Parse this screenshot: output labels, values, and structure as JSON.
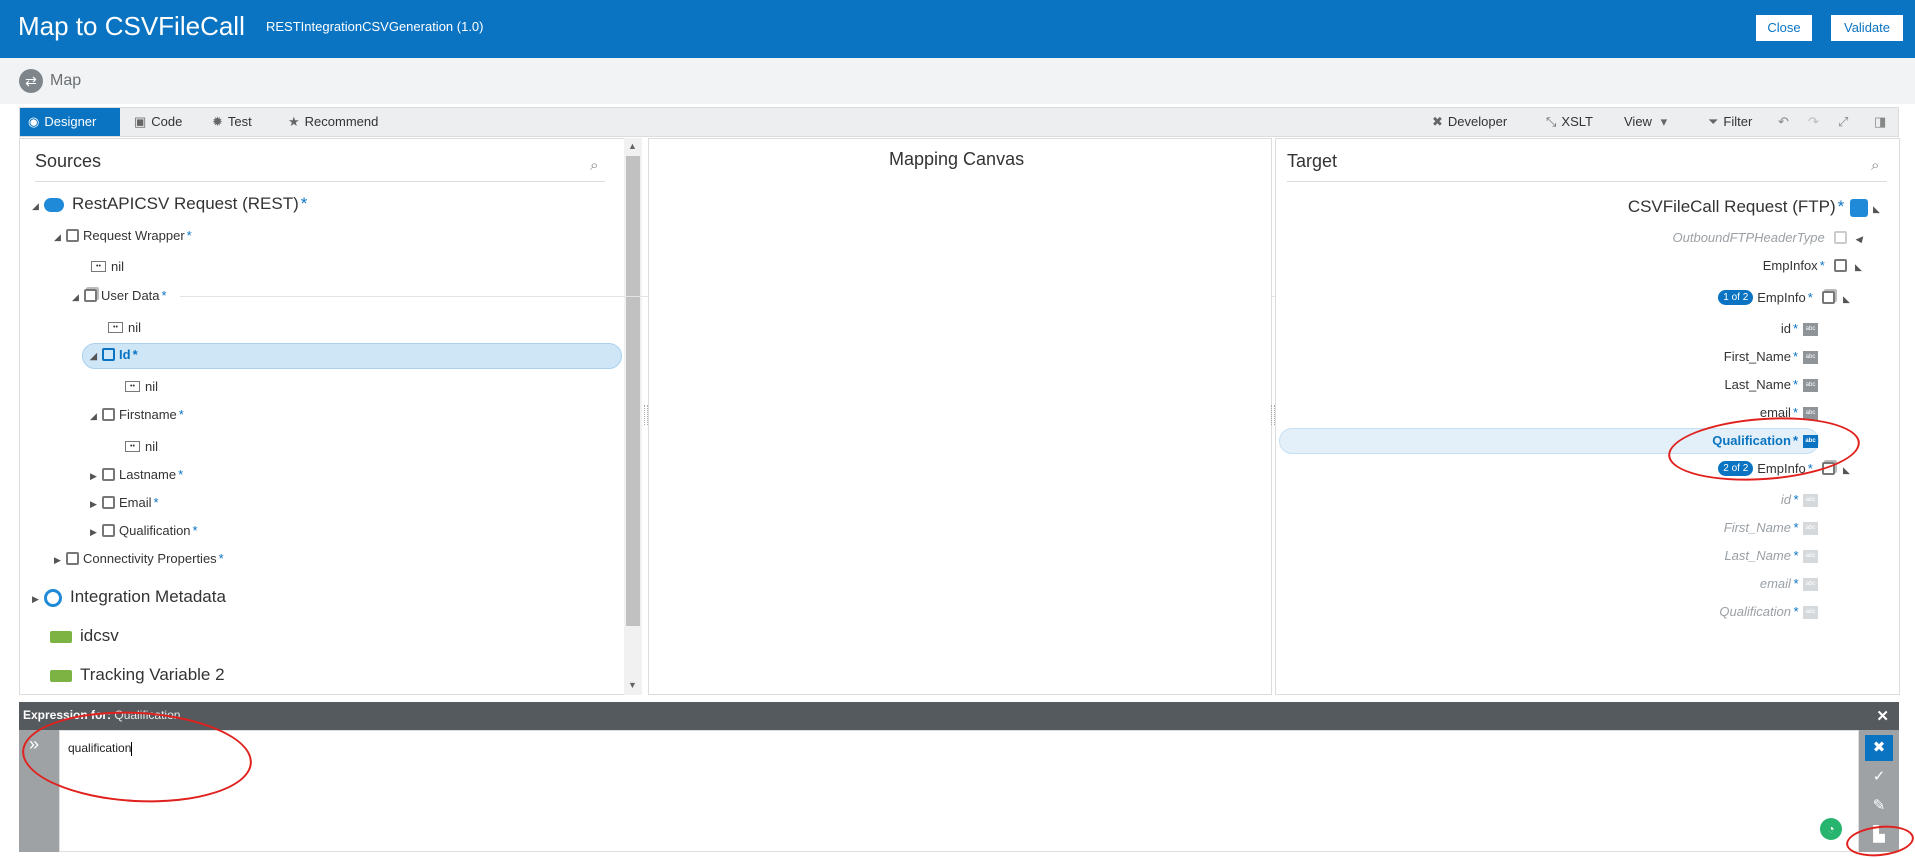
{
  "header": {
    "title": "Map to CSVFileCall",
    "subtitle": "RESTIntegrationCSVGeneration (1.0)",
    "close_label": "Close",
    "validate_label": "Validate"
  },
  "breadcrumb": {
    "label": "Map"
  },
  "toolbar": {
    "left": [
      {
        "label": "Designer",
        "icon": "designer-icon"
      },
      {
        "label": "Code",
        "icon": "code-icon"
      },
      {
        "label": "Test",
        "icon": "gear-icon"
      },
      {
        "label": "Recommend",
        "icon": "star-icon"
      }
    ],
    "right": [
      {
        "label": "Developer",
        "icon": "wrench-icon"
      },
      {
        "label": "XSLT",
        "icon": "xslt-icon"
      },
      {
        "label": "View",
        "icon": "chevron-down-icon"
      },
      {
        "label": "Filter",
        "icon": "filter-icon"
      }
    ]
  },
  "sources": {
    "title": "Sources",
    "root": "RestAPICSV Request (REST)",
    "request_wrapper": "Request Wrapper",
    "nil": "nil",
    "user_data": "User Data",
    "id": "Id",
    "firstname": "Firstname",
    "lastname": "Lastname",
    "email": "Email",
    "qualification": "Qualification",
    "connectivity": "Connectivity Properties",
    "integration_metadata": "Integration Metadata",
    "idcsv": "idcsv",
    "tracking": "Tracking Variable 2"
  },
  "canvas": {
    "title": "Mapping Canvas"
  },
  "target": {
    "title": "Target",
    "root": "CSVFileCall Request (FTP)",
    "header_type": "OutboundFTPHeaderType",
    "empinfox": "EmpInfox",
    "empinfo": "EmpInfo",
    "pill1": "1 of 2",
    "pill2": "2 of 2",
    "id": "id",
    "first_name": "First_Name",
    "last_name": "Last_Name",
    "email": "email",
    "qualification": "Qualification"
  },
  "expression": {
    "label_prefix": "Expression for:",
    "label_target": "Qualification",
    "value": "qualification"
  },
  "star": "*"
}
